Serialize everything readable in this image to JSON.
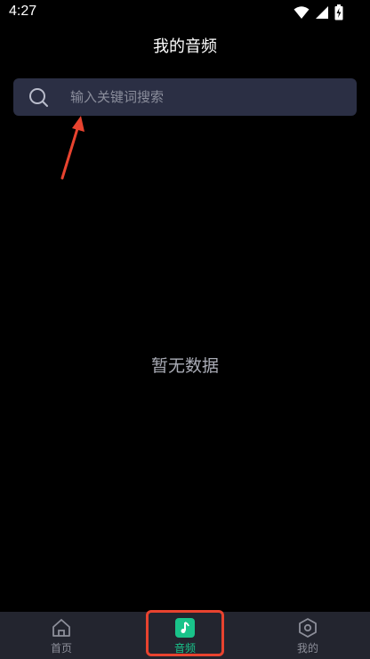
{
  "status_bar": {
    "time": "4:27",
    "icons": [
      "wifi-icon",
      "signal-icon",
      "battery-icon"
    ]
  },
  "header": {
    "title": "我的音频"
  },
  "search": {
    "placeholder": "输入关键词搜索",
    "value": ""
  },
  "content": {
    "empty_text": "暂无数据"
  },
  "bottom_nav": {
    "items": [
      {
        "label": "首页",
        "icon": "home-icon",
        "active": false
      },
      {
        "label": "音频",
        "icon": "music-note-icon",
        "active": true
      },
      {
        "label": "我的",
        "icon": "hexagon-settings-icon",
        "active": false
      }
    ]
  },
  "colors": {
    "background": "#000000",
    "search_bg": "#2b2f44",
    "nav_bg": "#23252f",
    "accent": "#19c38a",
    "annotation": "#e8432f"
  }
}
